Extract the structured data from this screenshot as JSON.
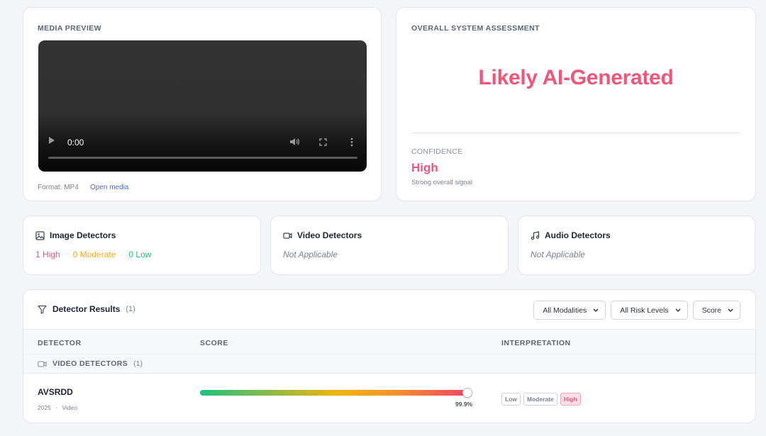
{
  "media": {
    "label": "MEDIA PREVIEW",
    "player_time": "0:00",
    "format": "Format: MP4",
    "open_link": "Open media"
  },
  "assessment": {
    "label": "OVERALL SYSTEM ASSESSMENT",
    "verdict": "Likely AI-Generated",
    "confidence_label": "CONFIDENCE",
    "confidence_value": "High",
    "confidence_sub": "Strong overall signal"
  },
  "detectors": {
    "image": {
      "title": "Image Detectors",
      "high": "1 High",
      "moderate": "0 Moderate",
      "low": "0 Low",
      "separator": "·"
    },
    "video": {
      "title": "Video Detectors",
      "status": "Not Applicable"
    },
    "audio": {
      "title": "Audio Detectors",
      "status": "Not Applicable"
    }
  },
  "results": {
    "title": "Detector Results",
    "count": "(1)",
    "filters": [
      "All Modalities",
      "All Risk Levels",
      "Score"
    ],
    "columns": {
      "detector": "DETECTOR",
      "score": "SCORE",
      "interpretation": "INTERPRETATION"
    },
    "group": {
      "label": "VIDEO DETECTORS",
      "count": "(1)"
    },
    "rows": [
      {
        "name": "AVSRDD",
        "year": "2025",
        "modality": "Video",
        "separator": "·",
        "score": 0.999,
        "score_label": "99.9%",
        "chips": [
          "Low",
          "Moderate",
          "High"
        ],
        "active_chip": "High"
      }
    ]
  },
  "colors": {
    "high": "#f0567a",
    "moderate": "#f2aa1c",
    "low": "#22c37a",
    "link": "#4f67d6"
  }
}
